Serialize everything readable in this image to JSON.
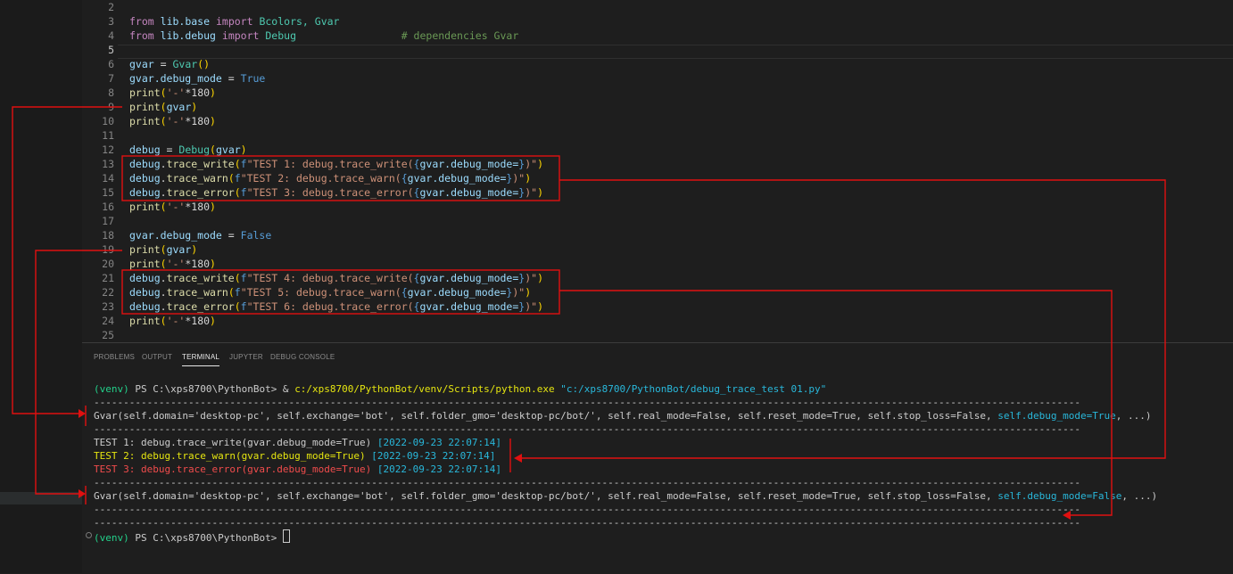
{
  "editor": {
    "lines": [
      {
        "n": "2"
      },
      {
        "n": "3"
      },
      {
        "n": "4"
      },
      {
        "n": "5"
      },
      {
        "n": "6"
      },
      {
        "n": "7"
      },
      {
        "n": "8"
      },
      {
        "n": "9"
      },
      {
        "n": "10"
      },
      {
        "n": "11"
      },
      {
        "n": "12"
      },
      {
        "n": "13"
      },
      {
        "n": "14"
      },
      {
        "n": "15"
      },
      {
        "n": "16"
      },
      {
        "n": "17"
      },
      {
        "n": "18"
      },
      {
        "n": "19"
      },
      {
        "n": "20"
      },
      {
        "n": "21"
      },
      {
        "n": "22"
      },
      {
        "n": "23"
      },
      {
        "n": "24"
      },
      {
        "n": "25"
      }
    ],
    "code": {
      "l3_from": "from",
      "l3_mod": "lib.base",
      "l3_import": "import",
      "l3_names": "Bcolors, Gvar",
      "l4_from": "from",
      "l4_mod": "lib.debug",
      "l4_import": "import",
      "l4_names": "Debug",
      "l4_comment": "# dependencies Gvar",
      "l6_var": "gvar",
      "l6_eq": " = ",
      "l6_cls": "Gvar",
      "l6_paren": "()",
      "l7_var": "gvar.debug_mode",
      "l7_eq": " = ",
      "l7_val": "True",
      "l8_fn": "print",
      "l8_str": "'-'",
      "l8_rest": "*180",
      "l9_fn": "print",
      "l9_arg": "gvar",
      "l10_fn": "print",
      "l10_str": "'-'",
      "l10_rest": "*180",
      "l12_var": "debug",
      "l12_eq": " = ",
      "l12_cls": "Debug",
      "l12_arg": "gvar",
      "l13_obj": "debug",
      "l13_fn": "trace_write",
      "l13_f": "f",
      "l13_str": "\"TEST 1: debug.trace_write(",
      "l13_expr": "gvar.debug_mode=",
      "l13_end": ")\"",
      "l14_obj": "debug",
      "l14_fn": "trace_warn",
      "l14_f": "f",
      "l14_str": "\"TEST 2: debug.trace_warn(",
      "l14_expr": "gvar.debug_mode=",
      "l14_end": ")\"",
      "l15_obj": "debug",
      "l15_fn": "trace_error",
      "l15_f": "f",
      "l15_str": "\"TEST 3: debug.trace_error(",
      "l15_expr": "gvar.debug_mode=",
      "l15_end": ")\"",
      "l16_fn": "print",
      "l16_str": "'-'",
      "l16_rest": "*180",
      "l18_var": "gvar.debug_mode",
      "l18_eq": " = ",
      "l18_val": "False",
      "l19_fn": "print",
      "l19_arg": "gvar",
      "l20_fn": "print",
      "l20_str": "'-'",
      "l20_rest": "*180",
      "l21_obj": "debug",
      "l21_fn": "trace_write",
      "l21_f": "f",
      "l21_str": "\"TEST 4: debug.trace_write(",
      "l21_expr": "gvar.debug_mode=",
      "l21_end": ")\"",
      "l22_obj": "debug",
      "l22_fn": "trace_warn",
      "l22_f": "f",
      "l22_str": "\"TEST 5: debug.trace_warn(",
      "l22_expr": "gvar.debug_mode=",
      "l22_end": ")\"",
      "l23_obj": "debug",
      "l23_fn": "trace_error",
      "l23_f": "f",
      "l23_str": "\"TEST 6: debug.trace_error(",
      "l23_expr": "gvar.debug_mode=",
      "l23_end": ")\"",
      "l24_fn": "print",
      "l24_str": "'-'",
      "l24_rest": "*180"
    }
  },
  "panel": {
    "tabs": [
      "PROBLEMS",
      "OUTPUT",
      "TERMINAL",
      "JUPYTER",
      "DEBUG CONSOLE"
    ],
    "active_tab": "TERMINAL"
  },
  "terminal": {
    "prompt_env": "(venv)",
    "prompt_ps": " PS C:\\xps8700\\PythonBot> & ",
    "python_path": "c:/xps8700/PythonBot/venv/Scripts/python.exe",
    "script_arg": "\"c:/xps8700/PythonBot/debug_trace_test 01.py\"",
    "separator": "-----------------------------------------------------------------------------------------------------------------------------------------------------------------------",
    "gvar_line_true_a": "Gvar(self.domain='desktop-pc', self.exchange='bot', self.folder_gmo='desktop-pc/bot/', self.real_mode=False, self.reset_mode=True, self.stop_loss=False, ",
    "gvar_line_true_b": "self.debug_mode=True",
    "gvar_line_true_c": ", ...)",
    "test1": "TEST 1: debug.trace_write(gvar.debug_mode=True)",
    "test2": "TEST 2: debug.trace_warn(gvar.debug_mode=True)",
    "test3": "TEST 3: debug.trace_error(gvar.debug_mode=True)",
    "timestamp": "[2022-09-23 22:07:14]",
    "gvar_line_false_a": "Gvar(self.domain='desktop-pc', self.exchange='bot', self.folder_gmo='desktop-pc/bot/', self.real_mode=False, self.reset_mode=True, self.stop_loss=False, ",
    "gvar_line_false_b": "self.debug_mode=False",
    "gvar_line_false_c": ", ...)",
    "final_prompt": " PS C:\\xps8700\\PythonBot> "
  },
  "colors": {
    "annotation": "#e01010",
    "editor_bg": "#1e1e1e"
  }
}
